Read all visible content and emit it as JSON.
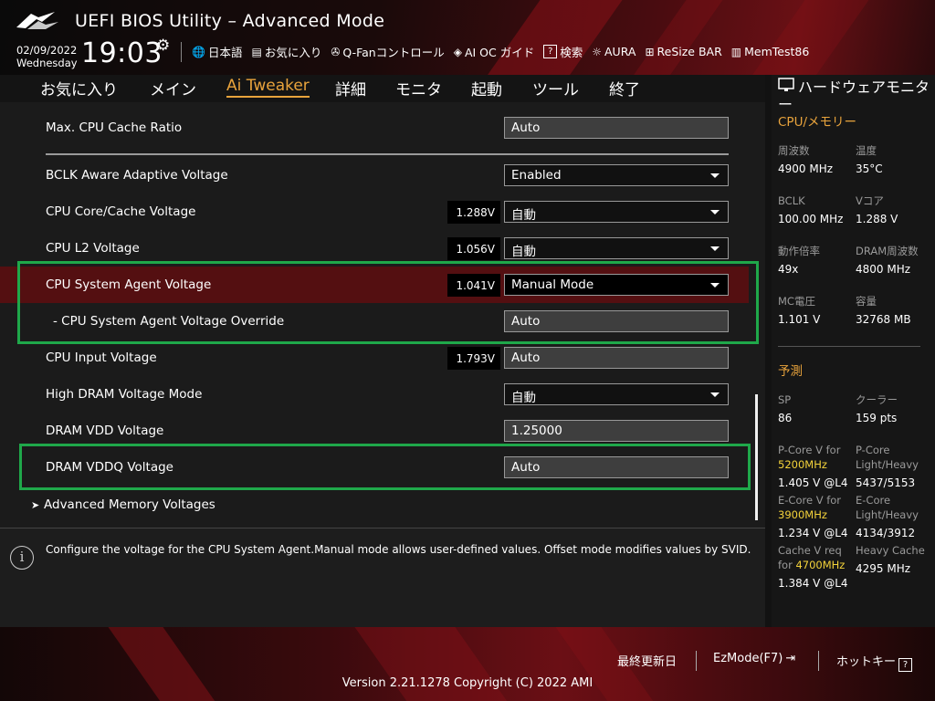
{
  "app": {
    "title": "UEFI BIOS Utility – Advanced Mode",
    "date": "02/09/2022",
    "weekday": "Wednesday",
    "time": "19:03"
  },
  "toolbar": [
    {
      "icon": "globe-icon",
      "glyph": "🌐",
      "label": "日本語"
    },
    {
      "icon": "favorites-icon",
      "glyph": "▤",
      "label": "お気に入り"
    },
    {
      "icon": "fan-icon",
      "glyph": "✇",
      "label": "Q-Fanコントロール"
    },
    {
      "icon": "ai-oc-icon",
      "glyph": "◈",
      "label": "AI OC ガイド"
    },
    {
      "icon": "search-icon",
      "glyph": "?",
      "label": "検索"
    },
    {
      "icon": "aura-icon",
      "glyph": "☼",
      "label": "AURA"
    },
    {
      "icon": "resize-bar-icon",
      "glyph": "⊞",
      "label": "ReSize BAR"
    },
    {
      "icon": "memtest-icon",
      "glyph": "▥",
      "label": "MemTest86"
    }
  ],
  "tabs": [
    "お気に入り",
    "メイン",
    "Ai Tweaker",
    "詳細",
    "モニタ",
    "起動",
    "ツール",
    "終了"
  ],
  "active_tab": "Ai Tweaker",
  "settings": [
    {
      "label": "Max. CPU Cache Ratio",
      "voltage": "",
      "value": "Auto",
      "kind": "plain"
    },
    {
      "label": "BCLK Aware Adaptive Voltage",
      "voltage": "",
      "value": "Enabled",
      "kind": "drop"
    },
    {
      "label": "CPU Core/Cache Voltage",
      "voltage": "1.288V",
      "value": "自動",
      "kind": "drop"
    },
    {
      "label": "CPU L2 Voltage",
      "voltage": "1.056V",
      "value": "自動",
      "kind": "drop"
    },
    {
      "label": "CPU System Agent Voltage",
      "voltage": "1.041V",
      "value": "Manual Mode",
      "kind": "drop"
    },
    {
      "label": "- CPU System Agent Voltage Override",
      "voltage": "",
      "value": "Auto",
      "kind": "plain"
    },
    {
      "label": "CPU Input Voltage",
      "voltage": "1.793V",
      "value": "Auto",
      "kind": "plain"
    },
    {
      "label": "High DRAM Voltage Mode",
      "voltage": "",
      "value": "自動",
      "kind": "drop"
    },
    {
      "label": "DRAM VDD Voltage",
      "voltage": "",
      "value": "1.25000",
      "kind": "plain"
    },
    {
      "label": "DRAM VDDQ Voltage",
      "voltage": "",
      "value": "Auto",
      "kind": "plain"
    }
  ],
  "submenu": "Advanced Memory Voltages",
  "help_text": "Configure the voltage for the CPU System Agent.Manual mode allows user-defined values. Offset mode modifies values by SVID.",
  "hw_monitor": {
    "title": "ハードウェアモニター",
    "cpu_mem_title": "CPU/メモリー",
    "cpu_mem": [
      {
        "label": "周波数",
        "value": "4900 MHz"
      },
      {
        "label": "温度",
        "value": "35°C"
      },
      {
        "label": "BCLK",
        "value": "100.00 MHz"
      },
      {
        "label": "Vコア",
        "value": "1.288 V"
      },
      {
        "label": "動作倍率",
        "value": "49x"
      },
      {
        "label": "DRAM周波数",
        "value": "4800 MHz"
      },
      {
        "label": "MC電圧",
        "value": "1.101 V"
      },
      {
        "label": "容量",
        "value": "32768 MB"
      }
    ],
    "predict_title": "予測",
    "predict": {
      "sp_label": "SP",
      "sp_value": "86",
      "cooler_label": "クーラー",
      "cooler_value": "159 pts",
      "pcore_v_label": "P-Core V for",
      "pcore_v_freq": "5200MHz",
      "pcore_v_value": "1.405 V @L4",
      "pcore_lh_label1": "P-Core",
      "pcore_lh_label2": "Light/Heavy",
      "pcore_lh_value": "5437/5153",
      "ecore_v_label": "E-Core V for",
      "ecore_v_freq": "3900MHz",
      "ecore_v_value": "1.234 V @L4",
      "ecore_lh_label1": "E-Core",
      "ecore_lh_label2": "Light/Heavy",
      "ecore_lh_value": "4134/3912",
      "cache_label1": "Cache V req",
      "cache_label2_pre": "for ",
      "cache_freq": "4700MHz",
      "cache_value": "1.384 V @L4",
      "heavy_cache_label": "Heavy Cache",
      "heavy_cache_value": "4295 MHz"
    }
  },
  "footer": {
    "last_modified": "最終更新日",
    "ezmode": "EzMode(F7)",
    "hotkeys": "ホットキー",
    "hotkey_glyph": "?",
    "version": "Version 2.21.1278 Copyright (C) 2022 AMI"
  },
  "colors": {
    "accent": "#e8a33c",
    "highlight_box": "#1fa84a",
    "selected_row": "#540f11",
    "frequency_highlight": "#f3d23a"
  }
}
